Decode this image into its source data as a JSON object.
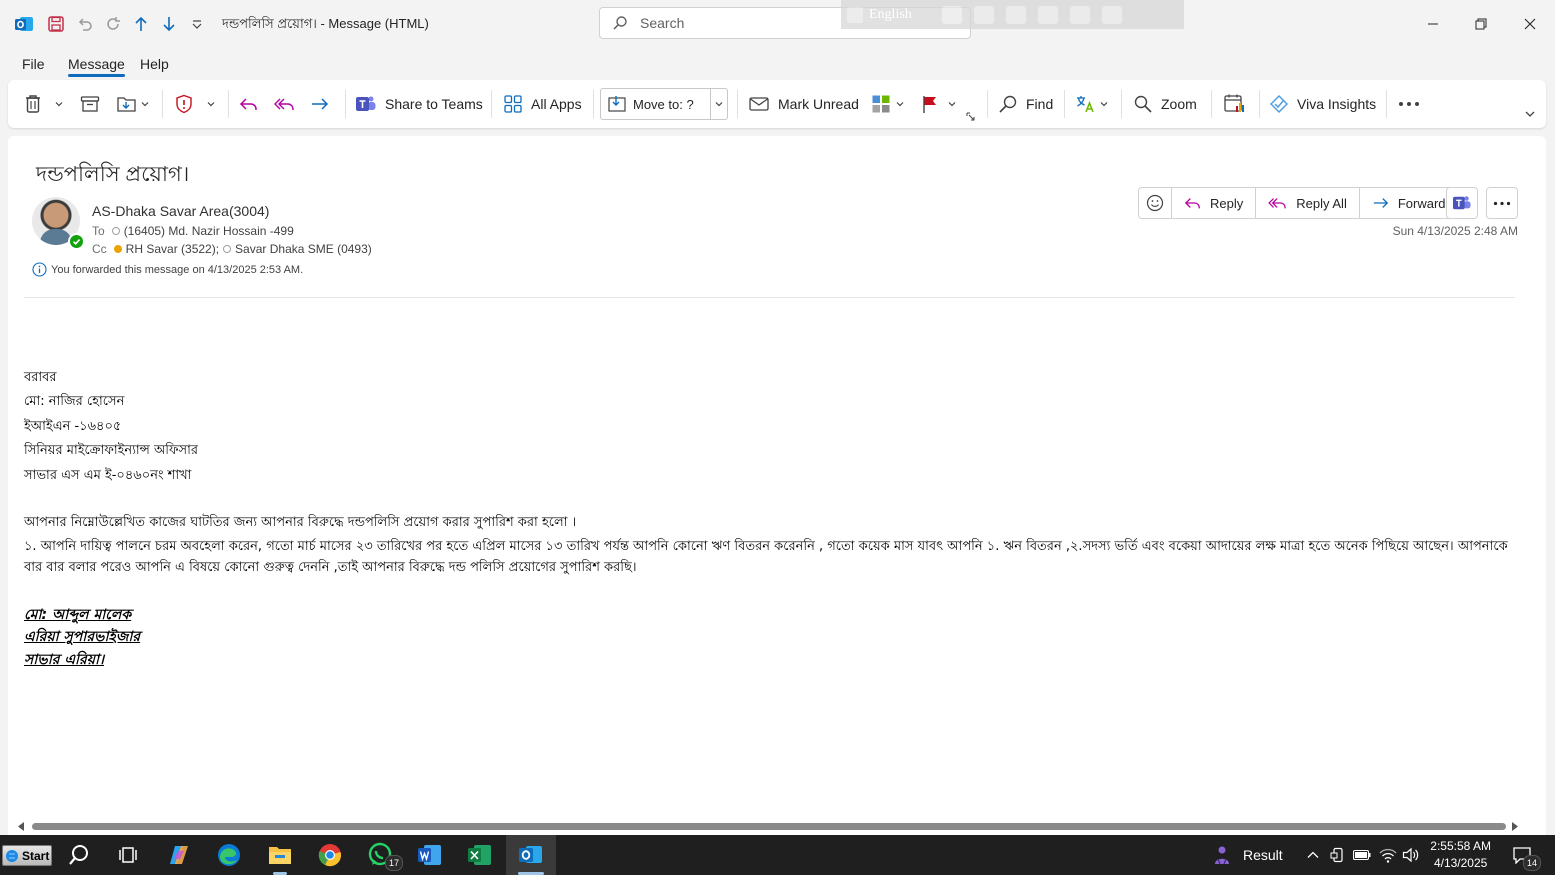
{
  "window": {
    "title": "দন্ডপলিসি প্রয়োগ। - Message (HTML)",
    "search_placeholder": "Search",
    "ime_language": "English"
  },
  "menu": {
    "file": "File",
    "message": "Message",
    "help": "Help"
  },
  "ribbon": {
    "share_to_teams": "Share to Teams",
    "all_apps": "All Apps",
    "move_to": "Move to: ?",
    "mark_unread": "Mark Unread",
    "find": "Find",
    "zoom": "Zoom",
    "viva_insights": "Viva Insights"
  },
  "email": {
    "subject": "দন্ডপলিসি প্রয়োগ।",
    "sender": "AS-Dhaka Savar Area(3004)",
    "to_label": "To",
    "to": "(16405) Md. Nazir Hossain -499",
    "cc_label": "Cc",
    "cc": [
      {
        "name": "RH Savar (3522);",
        "status": "away"
      },
      {
        "name": "Savar Dhaka SME (0493)",
        "status": "unknown"
      }
    ],
    "forward_info": "You forwarded this message on 4/13/2025 2:53 AM.",
    "date": "Sun 4/13/2025 2:48 AM",
    "actions": {
      "reply": "Reply",
      "reply_all": "Reply All",
      "forward": "Forward"
    },
    "body": {
      "line1": "বরাবর",
      "line2": "মো: নাজির হোসেন",
      "line3": "ইআইএন -১৬৪০৫",
      "line4": "সিনিয়র মাইক্রোফাইন্যান্স অফিসার",
      "line5": "সাভার এস এম ই-০৪৬০নং শাখা",
      "para1": "আপনার নিম্নোউল্লেখিত কাজের ঘাটতির জন্য আপনার বিরুদ্ধে দন্ডপলিসি প্রয়োগ করার সুপারিশ করা হলো ।",
      "para2": "১. আপনি দায়িত্ব পালনে চরম অবহেলা করেন, গতো মার্চ মাসের ২৩ তারিখের পর হতে এপ্রিল মাসের ১৩ তারিখ পর্যন্ত আপনি কোনো ঋণ বিতরন করেননি , গতো কয়েক মাস যাবৎ আপনি ১. ঋন বিতরন ,২.সদস্য ভর্তি এবং বকেয়া আদায়ের লক্ষ মাত্রা হতে অনেক পিছিয়ে আছেন। আপনাকে বার বার বলার পরেও আপনি এ বিষয়ে কোনো গুরুত্ব দেননি ,তাই আপনার বিরুদ্ধে দন্ড পলিসি প্রয়োগের সুপারিশ করছি।",
      "sig1": "মো: আব্দুল মালেক",
      "sig2": "এরিয়া সুপারভাইজার",
      "sig3": "সাভার এরিয়া।"
    }
  },
  "taskbar": {
    "start": "Start",
    "whatsapp_badge": "17",
    "tray_result": "Result",
    "time": "2:55:58 AM",
    "date": "4/13/2025",
    "notifications": "14"
  },
  "colors": {
    "accent": "#0f6cbd",
    "flag": "#c50f1f",
    "presence_available": "#13a10e",
    "presence_away": "#eaa300"
  }
}
